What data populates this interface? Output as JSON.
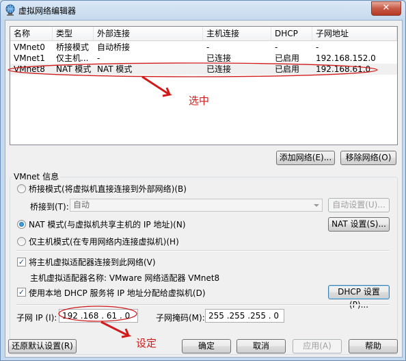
{
  "window": {
    "title": "虚拟网络编辑器",
    "close_glyph": "✕"
  },
  "list": {
    "headers": [
      "名称",
      "类型",
      "外部连接",
      "主机连接",
      "DHCP",
      "子网地址"
    ],
    "rows": [
      [
        "VMnet0",
        "桥接模式",
        "自动桥接",
        "-",
        "-",
        "-"
      ],
      [
        "VMnet1",
        "仅主机...",
        "-",
        "已连接",
        "已启用",
        "192.168.152.0"
      ],
      [
        "VMnet8",
        "NAT 模式",
        "NAT 模式",
        "已连接",
        "已启用",
        "192.168.61.0"
      ]
    ],
    "selected_index": 2
  },
  "buttons": {
    "add_network": "添加网络(E)...",
    "remove_network": "移除网络(O)",
    "auto_settings": "自动设置(U)...",
    "nat_settings": "NAT 设置(S)...",
    "dhcp_settings": "DHCP 设置(P)...",
    "restore_defaults": "还原默认设置(R)",
    "ok": "确定",
    "cancel": "取消",
    "apply": "应用(A)",
    "help": "帮助"
  },
  "vmnet_info": {
    "group_label": "VMnet 信息",
    "bridged_label": "桥接模式(将虚拟机直接连接到外部网络)(B)",
    "bridged_to_label": "桥接到(T):",
    "bridged_to_value": "自动",
    "nat_label": "NAT 模式(与虚拟机共享主机的 IP 地址)(N)",
    "hostonly_label": "仅主机模式(在专用网络内连接虚拟机)(H)",
    "selected_mode": "nat",
    "connect_adapter_label": "将主机虚拟适配器连接到此网络(V)",
    "connect_adapter_checked": true,
    "adapter_name_text": "主机虚拟适配器名称: VMware 网络适配器 VMnet8",
    "use_dhcp_label": "使用本地 DHCP 服务将 IP 地址分配给虚拟机(D)",
    "use_dhcp_checked": true,
    "subnet_ip_label": "子网 IP (I):",
    "subnet_ip_value": "192 .168 . 61 . 0",
    "subnet_mask_label": "子网掩码(M):",
    "subnet_mask_value": "255 .255 .255 . 0"
  },
  "annotations": {
    "select_note": "选中",
    "set_note": "设定",
    "color": "#d01b1b"
  }
}
